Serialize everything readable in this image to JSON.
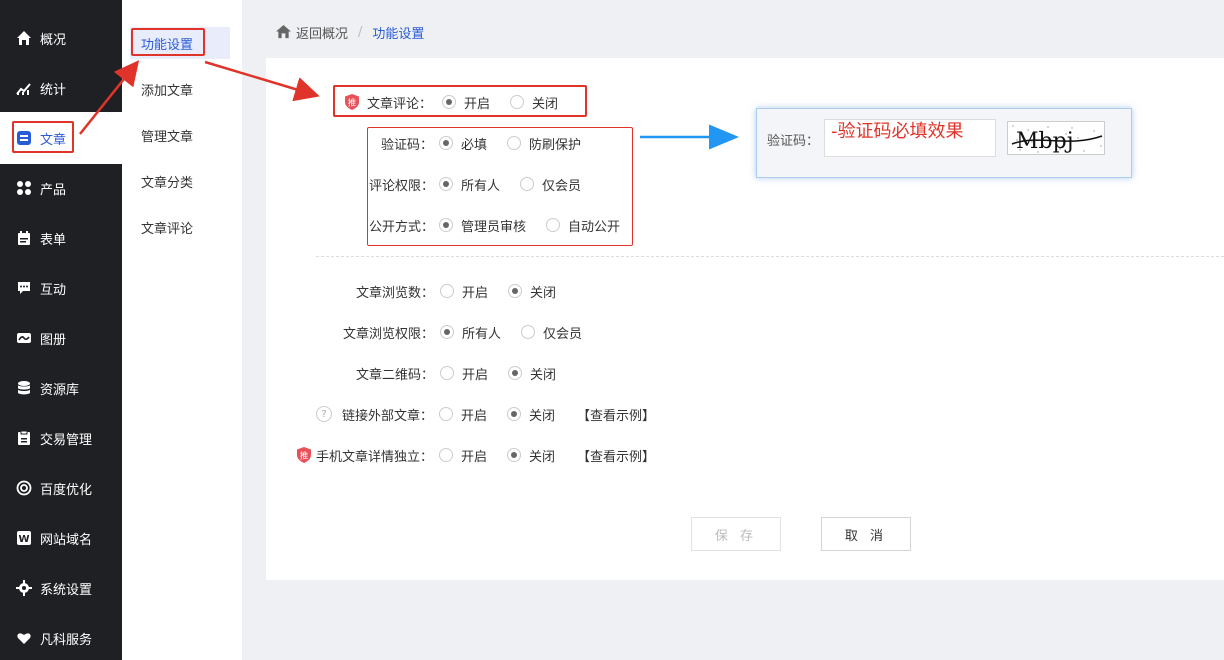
{
  "nav": {
    "items": [
      {
        "label": "概况",
        "icon": "home-icon"
      },
      {
        "label": "统计",
        "icon": "chart-icon"
      },
      {
        "label": "文章",
        "icon": "article-icon"
      },
      {
        "label": "产品",
        "icon": "grid-icon"
      },
      {
        "label": "表单",
        "icon": "calendar-icon"
      },
      {
        "label": "互动",
        "icon": "chat-icon"
      },
      {
        "label": "图册",
        "icon": "album-icon"
      },
      {
        "label": "资源库",
        "icon": "database-icon"
      },
      {
        "label": "交易管理",
        "icon": "clipboard-icon"
      },
      {
        "label": "百度优化",
        "icon": "target-icon"
      },
      {
        "label": "网站域名",
        "icon": "w-icon"
      },
      {
        "label": "系统设置",
        "icon": "gear-icon"
      },
      {
        "label": "凡科服务",
        "icon": "heart-icon"
      }
    ]
  },
  "subnav": {
    "items": [
      {
        "label": "功能设置"
      },
      {
        "label": "添加文章"
      },
      {
        "label": "管理文章"
      },
      {
        "label": "文章分类"
      },
      {
        "label": "文章评论"
      }
    ]
  },
  "breadcrumb": {
    "back": "返回概况",
    "sep": "/",
    "current": "功能设置"
  },
  "settings": {
    "comment": {
      "label": "文章评论：",
      "badge": "推",
      "on": "开启",
      "off": "关闭"
    },
    "captcha": {
      "label": "验证码：",
      "opt1": "必填",
      "opt2": "防刷保护"
    },
    "perm": {
      "label": "评论权限：",
      "opt1": "所有人",
      "opt2": "仅会员"
    },
    "public": {
      "label": "公开方式：",
      "opt1": "管理员审核",
      "opt2": "自动公开"
    },
    "views": {
      "label": "文章浏览数：",
      "on": "开启",
      "off": "关闭"
    },
    "viewperm": {
      "label": "文章浏览权限：",
      "opt1": "所有人",
      "opt2": "仅会员"
    },
    "qrcode": {
      "label": "文章二维码：",
      "on": "开启",
      "off": "关闭"
    },
    "extlink": {
      "label": "链接外部文章：",
      "help": "?",
      "on": "开启",
      "off": "关闭",
      "example": "【查看示例】"
    },
    "mobile": {
      "label": "手机文章详情独立：",
      "badge": "推",
      "on": "开启",
      "off": "关闭",
      "example": "【查看示例】"
    }
  },
  "buttons": {
    "save": "保 存",
    "cancel": "取 消"
  },
  "captcha_demo": {
    "label": "验证码：",
    "note": "-验证码必填效果",
    "code": "Mbpj"
  },
  "colors": {
    "accent": "#2a5bd7",
    "annotation": "#e0342b",
    "arrow": "#2196f3",
    "nav_bg": "#1f2024"
  }
}
